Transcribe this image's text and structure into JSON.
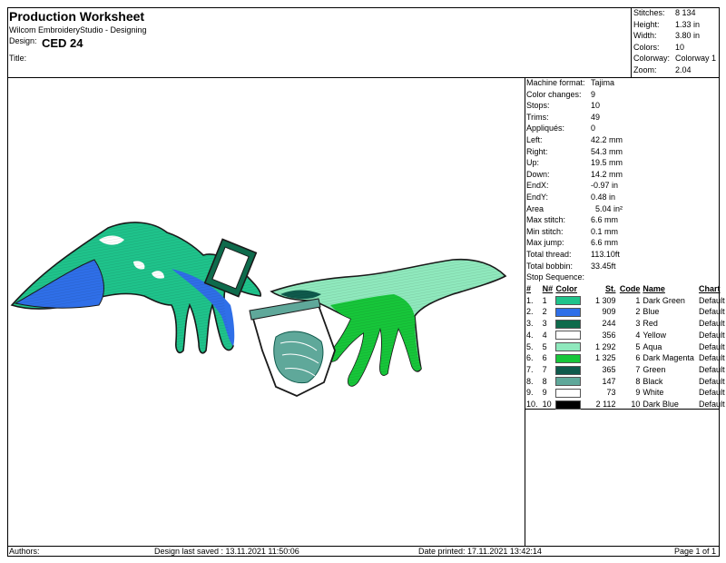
{
  "header": {
    "title": "Production Worksheet",
    "subtitle": "Wilcom EmbroideryStudio - Designing",
    "design_label": "Design:",
    "design_value": "CED 24",
    "title_label": "Title:"
  },
  "summary": [
    {
      "label": "Stitches:",
      "value": "8 134"
    },
    {
      "label": "Height:",
      "value": "1.33 in"
    },
    {
      "label": "Width:",
      "value": "3.80 in"
    },
    {
      "label": "Colors:",
      "value": "10"
    },
    {
      "label": "Colorway:",
      "value": "Colorway 1"
    },
    {
      "label": "Zoom:",
      "value": "2.04"
    }
  ],
  "machine_info": [
    {
      "label": "Machine format:",
      "value": "Tajima"
    },
    {
      "label": "Color changes:",
      "value": "9"
    },
    {
      "label": "Stops:",
      "value": "10"
    },
    {
      "label": "Trims:",
      "value": "49"
    },
    {
      "label": "Appliqués:",
      "value": "0"
    },
    {
      "label": "Left:",
      "value": "42.2 mm"
    },
    {
      "label": "Right:",
      "value": "54.3 mm"
    },
    {
      "label": "Up:",
      "value": "19.5 mm"
    },
    {
      "label": "Down:",
      "value": "14.2 mm"
    },
    {
      "label": "EndX:",
      "value": "-0.97 in"
    },
    {
      "label": "EndY:",
      "value": "0.48 in"
    },
    {
      "label": "Area",
      "value": "  5.04 in²"
    },
    {
      "label": "Max stitch:",
      "value": "6.6 mm"
    },
    {
      "label": "Min stitch:",
      "value": "0.1 mm"
    },
    {
      "label": "Max jump:",
      "value": "6.6 mm"
    },
    {
      "label": "Total thread:",
      "value": "113.10ft"
    },
    {
      "label": "Total bobbin:",
      "value": "33.45ft"
    },
    {
      "label": "Stop Sequence:",
      "value": ""
    }
  ],
  "sequence": {
    "headers": {
      "idx": "#",
      "n": "N#",
      "color": "Color",
      "st": "St.",
      "code": "Code",
      "name": "Name",
      "chart": "Chart"
    },
    "rows": [
      {
        "idx": "1.",
        "n": "1",
        "hex": "#1fc38b",
        "st": "1 309",
        "code": "1",
        "name": "Dark Green",
        "chart": "Default"
      },
      {
        "idx": "2.",
        "n": "2",
        "hex": "#2f6fe8",
        "st": "909",
        "code": "2",
        "name": "Blue",
        "chart": "Default"
      },
      {
        "idx": "3.",
        "n": "3",
        "hex": "#0e6b4c",
        "st": "244",
        "code": "3",
        "name": "Red",
        "chart": "Default"
      },
      {
        "idx": "4.",
        "n": "4",
        "hex": "#ffffff",
        "st": "356",
        "code": "4",
        "name": "Yellow",
        "chart": "Default"
      },
      {
        "idx": "5.",
        "n": "5",
        "hex": "#8fe9bd",
        "st": "1 292",
        "code": "5",
        "name": "Aqua",
        "chart": "Default"
      },
      {
        "idx": "6.",
        "n": "6",
        "hex": "#17c63a",
        "st": "1 325",
        "code": "6",
        "name": "Dark Magenta",
        "chart": "Default"
      },
      {
        "idx": "7.",
        "n": "7",
        "hex": "#0f5a4c",
        "st": "365",
        "code": "7",
        "name": "Green",
        "chart": "Default"
      },
      {
        "idx": "8.",
        "n": "8",
        "hex": "#5fa89a",
        "st": "147",
        "code": "8",
        "name": "Black",
        "chart": "Default"
      },
      {
        "idx": "9.",
        "n": "9",
        "hex": "#ffffff",
        "st": "73",
        "code": "9",
        "name": "White",
        "chart": "Default"
      },
      {
        "idx": "10.",
        "n": "10",
        "hex": "#000000",
        "st": "2 112",
        "code": "10",
        "name": "Dark Blue",
        "chart": "Default"
      }
    ]
  },
  "footer": {
    "authors": "Authors:",
    "saved": "Design last saved : 13.11.2021 11:50:06",
    "printed": "Date printed: 17.11.2021 13:42:14",
    "page": "Page 1 of 1"
  }
}
